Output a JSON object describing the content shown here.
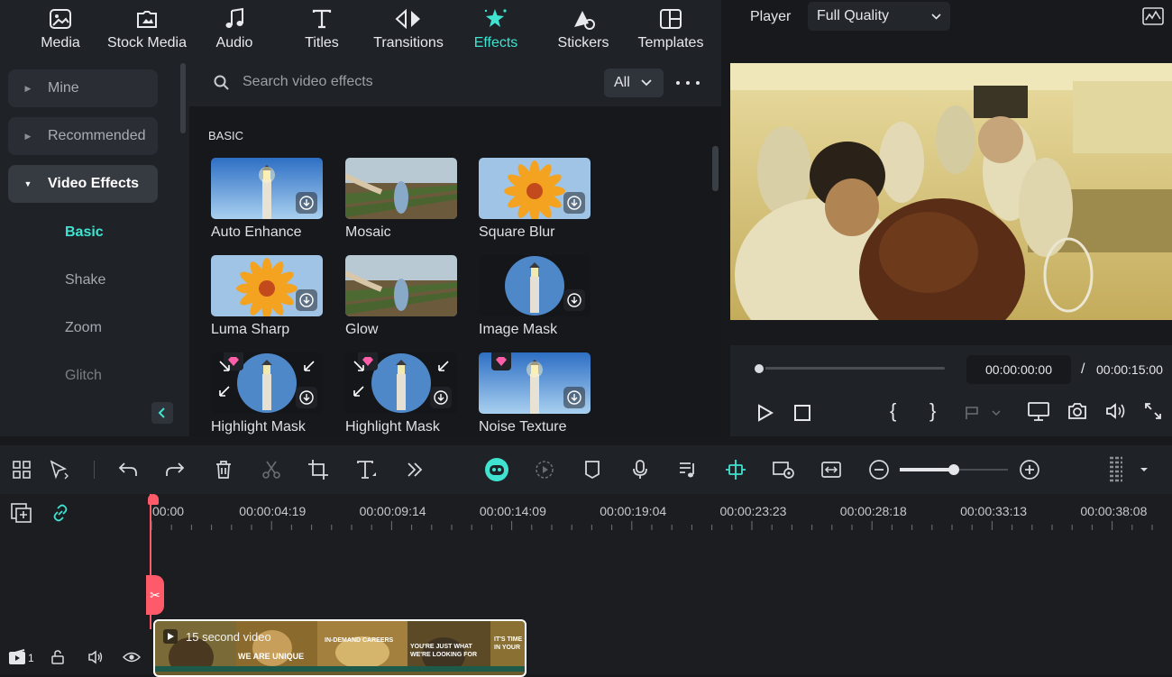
{
  "tabs": [
    {
      "label": "Media",
      "icon": "media-icon",
      "active": false
    },
    {
      "label": "Stock Media",
      "icon": "stock-media-icon",
      "active": false
    },
    {
      "label": "Audio",
      "icon": "music-note-icon",
      "active": false
    },
    {
      "label": "Titles",
      "icon": "titles-icon",
      "active": false
    },
    {
      "label": "Transitions",
      "icon": "transitions-icon",
      "active": false
    },
    {
      "label": "Effects",
      "icon": "effects-sparkle-icon",
      "active": true
    },
    {
      "label": "Stickers",
      "icon": "stickers-icon",
      "active": false
    },
    {
      "label": "Templates",
      "icon": "templates-icon",
      "active": false
    }
  ],
  "sidebar": {
    "items": [
      {
        "label": "Mine",
        "expanded": false
      },
      {
        "label": "Recommended",
        "expanded": false
      },
      {
        "label": "Video Effects",
        "expanded": true
      }
    ],
    "subitems": [
      {
        "label": "Basic",
        "active": true
      },
      {
        "label": "Shake",
        "active": false
      },
      {
        "label": "Zoom",
        "active": false
      },
      {
        "label": "Glitch",
        "active": false
      }
    ]
  },
  "search": {
    "placeholder": "Search video effects",
    "filter": "All"
  },
  "section_title": "BASIC",
  "effects": [
    {
      "name": "Auto Enhance",
      "thumb": "lighthouse",
      "download": true,
      "premium": false
    },
    {
      "name": "Mosaic",
      "thumb": "vineyard",
      "download": false,
      "premium": false
    },
    {
      "name": "Square Blur",
      "thumb": "flower",
      "download": true,
      "premium": false
    },
    {
      "name": "Luma Sharp",
      "thumb": "flower",
      "download": true,
      "premium": false
    },
    {
      "name": "Glow",
      "thumb": "vineyard",
      "download": false,
      "premium": false
    },
    {
      "name": "Image Mask",
      "thumb": "lighthouse-circle",
      "download": true,
      "premium": false
    },
    {
      "name": "Highlight Mask",
      "thumb": "lighthouse-circle",
      "download": true,
      "premium": true
    },
    {
      "name": "Highlight Mask",
      "thumb": "lighthouse-circle",
      "download": true,
      "premium": true
    },
    {
      "name": "Noise Texture",
      "thumb": "lighthouse",
      "download": true,
      "premium": true
    }
  ],
  "player": {
    "label": "Player",
    "quality": "Full Quality",
    "current_time": "00:00:00:00",
    "separator": "/",
    "total_time": "00:00:15:00",
    "progress": 0
  },
  "timeline": {
    "ticks": [
      "00:00",
      "00:00:04:19",
      "00:00:09:14",
      "00:00:14:09",
      "00:00:19:04",
      "00:00:23:23",
      "00:00:28:18",
      "00:00:33:13",
      "00:00:38:08"
    ],
    "clip_title": "15 second video",
    "clip_captions": [
      "WE ARE UNIQUE",
      "IN-DEMAND CAREERS",
      "YOU'RE JUST WHAT WE'RE LOOKING FOR",
      "IT'S TIME IN YOUR"
    ],
    "track_number": "1",
    "zoom_level": 0.5
  },
  "colors": {
    "accent": "#3fe3d0",
    "playhead": "#ff5a6a",
    "panel": "#1f2227",
    "background": "#17191d"
  }
}
